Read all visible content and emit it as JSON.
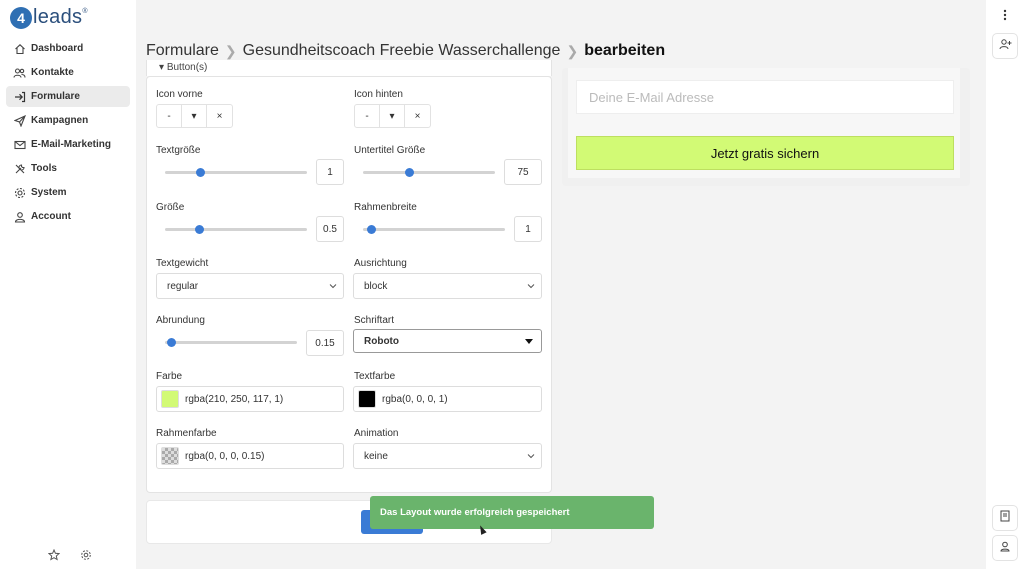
{
  "brand": {
    "logo_mark": "4",
    "logo_text": "leads",
    "registered": "®"
  },
  "sidebar": {
    "items": [
      {
        "label": "Dashboard",
        "icon": "home-icon"
      },
      {
        "label": "Kontakte",
        "icon": "users-icon"
      },
      {
        "label": "Formulare",
        "icon": "form-icon",
        "active": true
      },
      {
        "label": "Kampagnen",
        "icon": "send-icon"
      },
      {
        "label": "E-Mail-Marketing",
        "icon": "mail-icon"
      },
      {
        "label": "Tools",
        "icon": "tools-icon"
      },
      {
        "label": "System",
        "icon": "gear-icon"
      },
      {
        "label": "Account",
        "icon": "user-icon"
      }
    ]
  },
  "breadcrumb": {
    "root": "Formulare",
    "form": "Gesundheitscoach Freebie Wasserchallenge",
    "current": "bearbeiten"
  },
  "section": {
    "title": "Button(s)"
  },
  "fields": {
    "icon_vorne": {
      "label": "Icon vorne",
      "value": "-",
      "clear": "×"
    },
    "icon_hinten": {
      "label": "Icon hinten",
      "value": "-",
      "clear": "×"
    },
    "textgroesse": {
      "label": "Textgröße",
      "value": "1",
      "level": 0.25
    },
    "untertitel_groesse": {
      "label": "Untertitel Größe",
      "value": "75",
      "level": 0.35
    },
    "groesse": {
      "label": "Größe",
      "value": "0.5",
      "level": 0.24
    },
    "rahmenbreite": {
      "label": "Rahmenbreite",
      "value": "1",
      "level": 0.06
    },
    "textgewicht": {
      "label": "Textgewicht",
      "value": "regular"
    },
    "ausrichtung": {
      "label": "Ausrichtung",
      "value": "block"
    },
    "abrundung": {
      "label": "Abrundung",
      "value": "0.15",
      "level": 0.05
    },
    "schriftart": {
      "label": "Schriftart",
      "value": "Roboto"
    },
    "farbe": {
      "label": "Farbe",
      "value": "rgba(210, 250, 117, 1)",
      "swatch": "#d2fa75"
    },
    "textfarbe": {
      "label": "Textfarbe",
      "value": "rgba(0, 0, 0, 1)",
      "swatch": "#000000"
    },
    "rahmenfarbe": {
      "label": "Rahmenfarbe",
      "value": "rgba(0, 0, 0, 0.15)"
    },
    "animation": {
      "label": "Animation",
      "value": "keine"
    }
  },
  "preview": {
    "email_placeholder": "Deine E-Mail Adresse",
    "cta_label": "Jetzt gratis sichern"
  },
  "toast": {
    "message": "Das Layout wurde erfolgreich gespeichert"
  },
  "colors": {
    "accent": "#3a7bd5",
    "toast": "#6ab46c",
    "cta": "#d2fa75"
  }
}
